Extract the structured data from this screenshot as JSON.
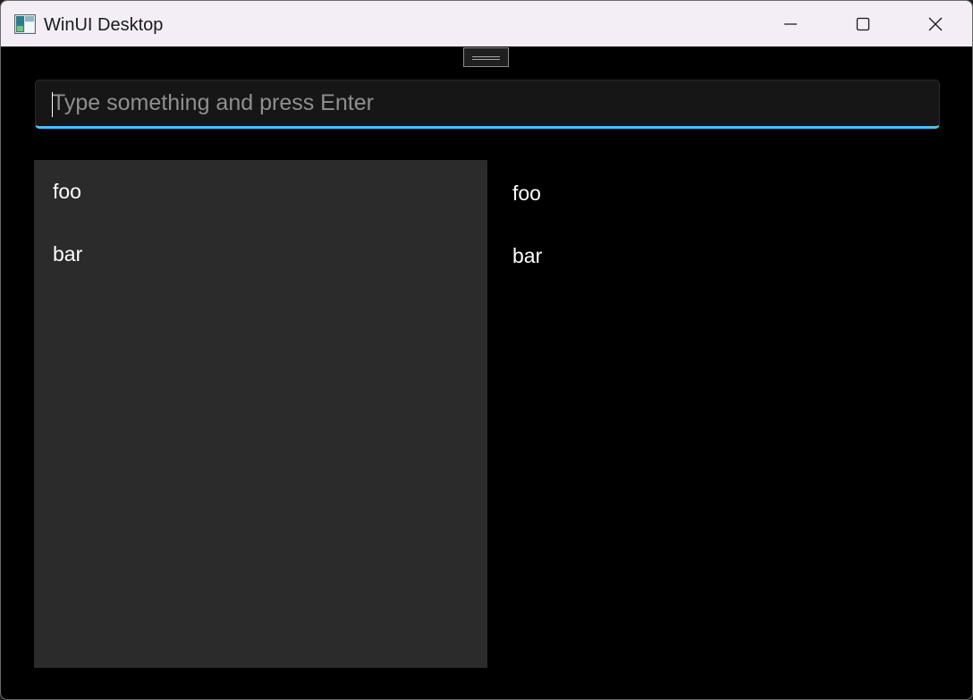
{
  "window": {
    "title": "WinUI Desktop",
    "icons": {
      "app": "app-icon",
      "minimize": "minimize-icon",
      "maximize": "maximize-icon",
      "close": "close-icon"
    }
  },
  "input": {
    "value": "",
    "placeholder": "Type something and press Enter",
    "accent": "#4cc2ff"
  },
  "list_left": {
    "items": [
      "foo",
      "bar"
    ],
    "background": "#2b2b2b"
  },
  "list_right": {
    "items": [
      "foo",
      "bar"
    ]
  }
}
